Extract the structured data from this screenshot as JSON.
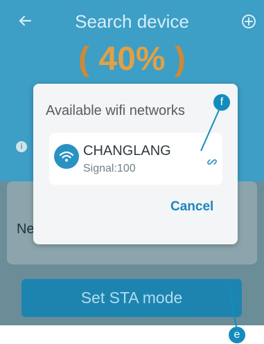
{
  "header": {
    "title": "Search device",
    "back_icon": "arrow-left-icon",
    "add_icon": "plus-circle-icon"
  },
  "progress": {
    "value_text": "40%",
    "open_paren": "(",
    "close_paren": ")"
  },
  "background": {
    "network_label": "Ne",
    "info_icon": "info-icon"
  },
  "buttons": {
    "set_sta_mode": "Set STA mode"
  },
  "dialog": {
    "title": "Available wifi networks",
    "networks": [
      {
        "ssid": "CHANGLANG",
        "signal": "Signal:100",
        "icon": "wifi-icon",
        "action_icon": "link-icon"
      }
    ],
    "cancel_label": "Cancel"
  },
  "annotations": {
    "f": "f",
    "e": "e"
  },
  "colors": {
    "accent": "#2a92c2",
    "progress": "#e0a146",
    "marker": "#148bbd"
  }
}
